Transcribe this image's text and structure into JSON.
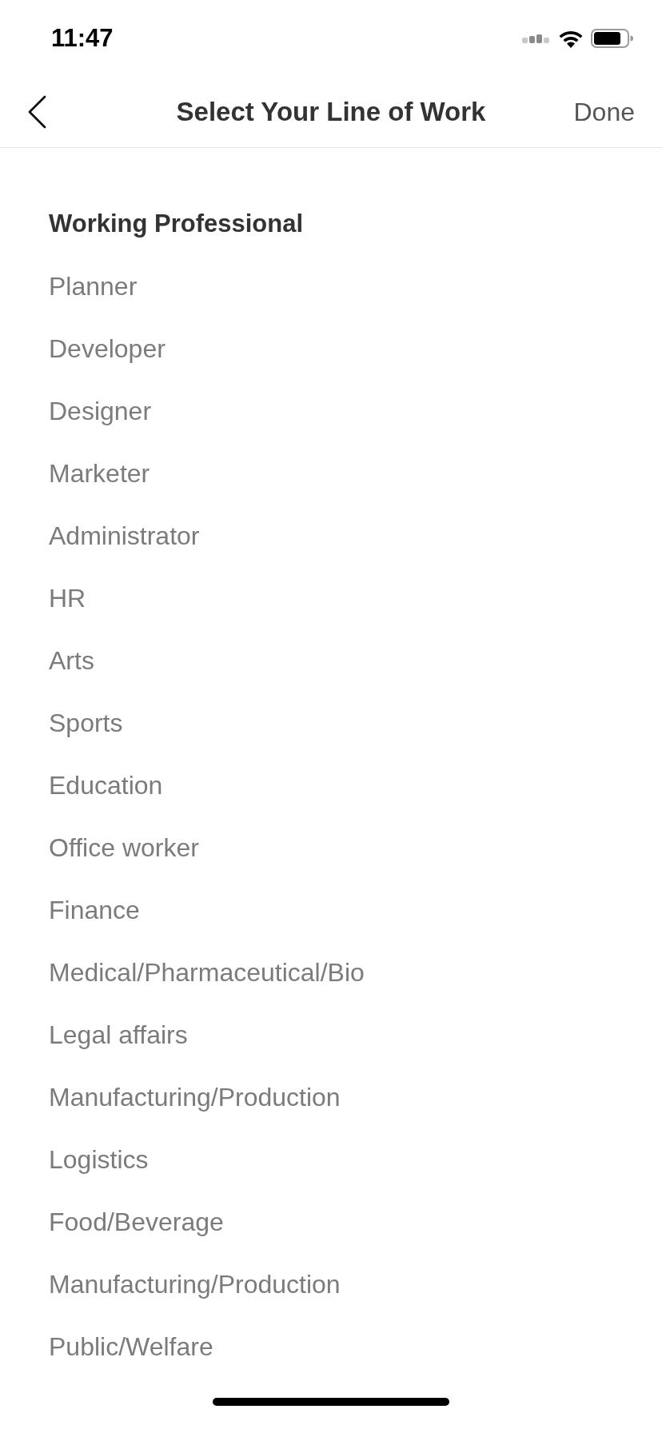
{
  "status_bar": {
    "time": "11:47"
  },
  "nav_bar": {
    "title": "Select Your Line of Work",
    "done_button": "Done"
  },
  "section": {
    "heading": "Working Professional",
    "options": [
      {
        "label": "Planner",
        "selected": false
      },
      {
        "label": "Developer",
        "selected": false
      },
      {
        "label": "Designer",
        "selected": false
      },
      {
        "label": "Marketer",
        "selected": false
      },
      {
        "label": "Administrator",
        "selected": false
      },
      {
        "label": "HR",
        "selected": false
      },
      {
        "label": "Arts",
        "selected": false
      },
      {
        "label": "Sports",
        "selected": false
      },
      {
        "label": "Education",
        "selected": false
      },
      {
        "label": "Office worker",
        "selected": false
      },
      {
        "label": "Finance",
        "selected": false
      },
      {
        "label": "Medical/Pharmaceutical/Bio",
        "selected": false
      },
      {
        "label": "Legal affairs",
        "selected": false
      },
      {
        "label": "Manufacturing/Production",
        "selected": false
      },
      {
        "label": "Logistics",
        "selected": false
      },
      {
        "label": "Food/Beverage",
        "selected": false
      },
      {
        "label": "Manufacturing/Production",
        "selected": false
      },
      {
        "label": "Public/Welfare",
        "selected": false
      }
    ]
  }
}
